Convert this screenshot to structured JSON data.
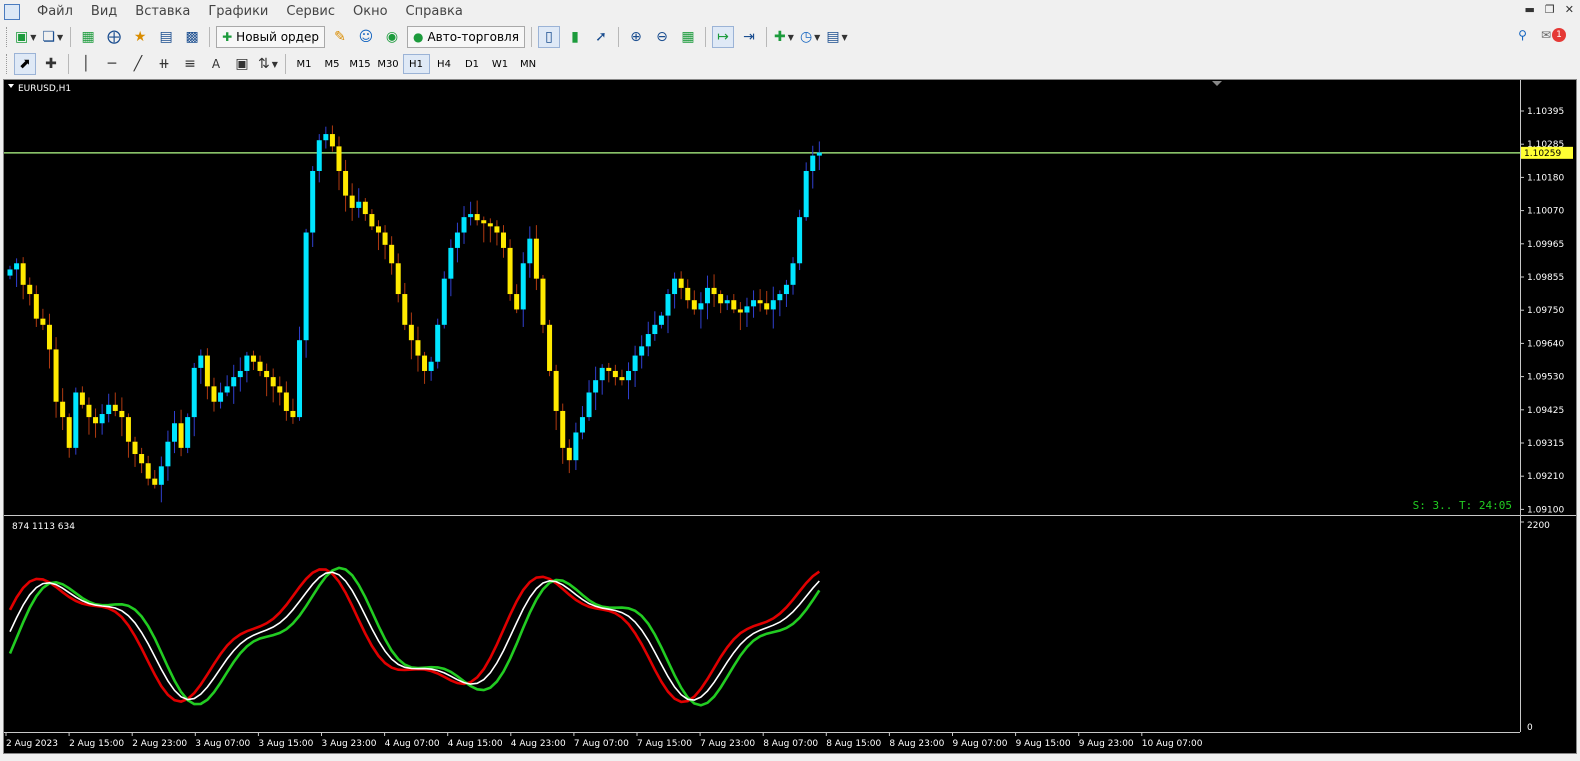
{
  "menu": {
    "items": [
      "Файл",
      "Вид",
      "Вставка",
      "Графики",
      "Сервис",
      "Окно",
      "Справка"
    ]
  },
  "toolbar": {
    "new_order_label": "Новый ордер",
    "autotrading_label": "Авто-торговля",
    "notification_count": "1"
  },
  "timeframes": [
    "M1",
    "M5",
    "M15",
    "M30",
    "H1",
    "H4",
    "D1",
    "W1",
    "MN"
  ],
  "active_timeframe": "H1",
  "chart": {
    "title": "EURUSD,H1",
    "price_levels": [
      "1.10395",
      "1.10285",
      "1.10180",
      "1.10070",
      "1.09965",
      "1.09855",
      "1.09750",
      "1.09640",
      "1.09530",
      "1.09425",
      "1.09315",
      "1.09210",
      "1.09100"
    ],
    "current_price": "1.10259",
    "status_text": "S: 3.. T: 24:05",
    "bull_color": "#00e5ff",
    "bear_color": "#ffea00"
  },
  "indicator": {
    "label": "874 1113 634",
    "scale_top": "2200",
    "scale_bottom": "0",
    "line_colors": [
      "#e00000",
      "#ffffff",
      "#22cc22"
    ]
  },
  "time_labels": [
    "2 Aug 2023",
    "2 Aug 15:00",
    "2 Aug 23:00",
    "3 Aug 07:00",
    "3 Aug 15:00",
    "3 Aug 23:00",
    "4 Aug 07:00",
    "4 Aug 15:00",
    "4 Aug 23:00",
    "7 Aug 07:00",
    "7 Aug 15:00",
    "7 Aug 23:00",
    "8 Aug 07:00",
    "8 Aug 15:00",
    "8 Aug 23:00",
    "9 Aug 07:00",
    "9 Aug 15:00",
    "9 Aug 23:00",
    "10 Aug 07:00"
  ]
}
